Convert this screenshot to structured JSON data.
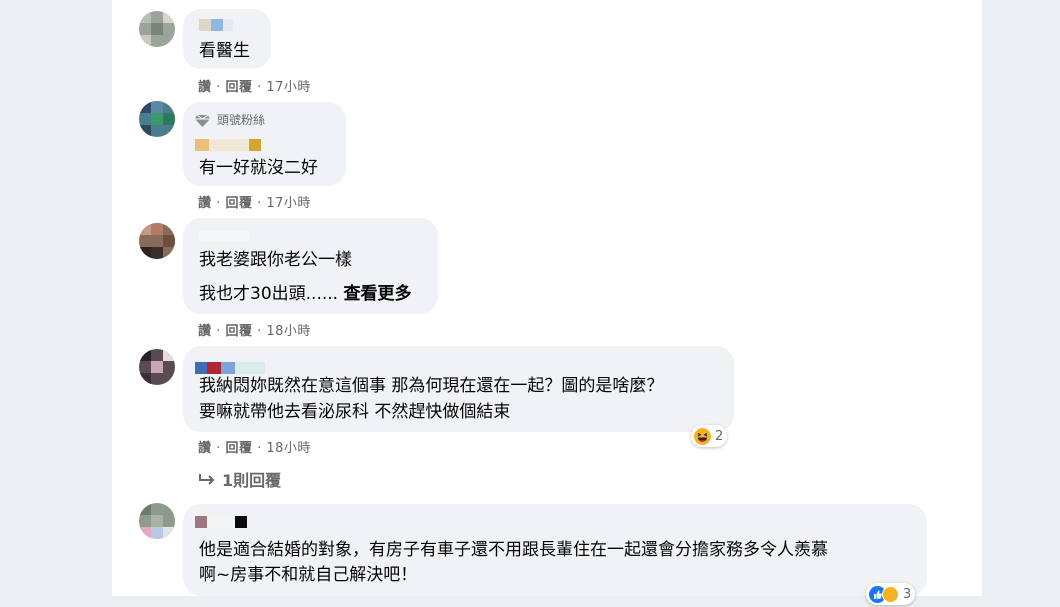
{
  "comments": [
    {
      "text_lines": [
        "看醫生"
      ],
      "actions": {
        "like": "讚",
        "reply": "回覆",
        "time": "17小時"
      }
    },
    {
      "badge": "頭號粉絲",
      "text_lines": [
        "有一好就沒二好"
      ],
      "actions": {
        "like": "讚",
        "reply": "回覆",
        "time": "17小時"
      }
    },
    {
      "text_lines": [
        "我老婆跟你老公一樣",
        "我也才30出頭......"
      ],
      "see_more": "查看更多",
      "actions": {
        "like": "讚",
        "reply": "回覆",
        "time": "18小時"
      }
    },
    {
      "text_lines": [
        "我納悶妳既然在意這個事 那為何現在還在一起？圖的是啥麼？",
        "要嘛就帶他去看泌尿科 不然趕快做個結束"
      ],
      "actions": {
        "like": "讚",
        "reply": "回覆",
        "time": "18小時"
      },
      "reactions": {
        "count": "2",
        "icon": "haha-emoji"
      },
      "replies_label": "1則回覆"
    },
    {
      "text_lines": [
        "他是適合結婚的對象，有房子有車子還不用跟長輩住在一起還會分擔家務多令人羨慕",
        "啊~房事不和就自己解決吧！"
      ],
      "reactions": {
        "count": "3",
        "icon": "like-emoji"
      }
    }
  ],
  "separator": "·",
  "colors": {
    "bubble": "#f0f2f5",
    "meta_text": "#65676b",
    "page_bg": "#eceff2",
    "panel_bg": "#ffffff"
  }
}
